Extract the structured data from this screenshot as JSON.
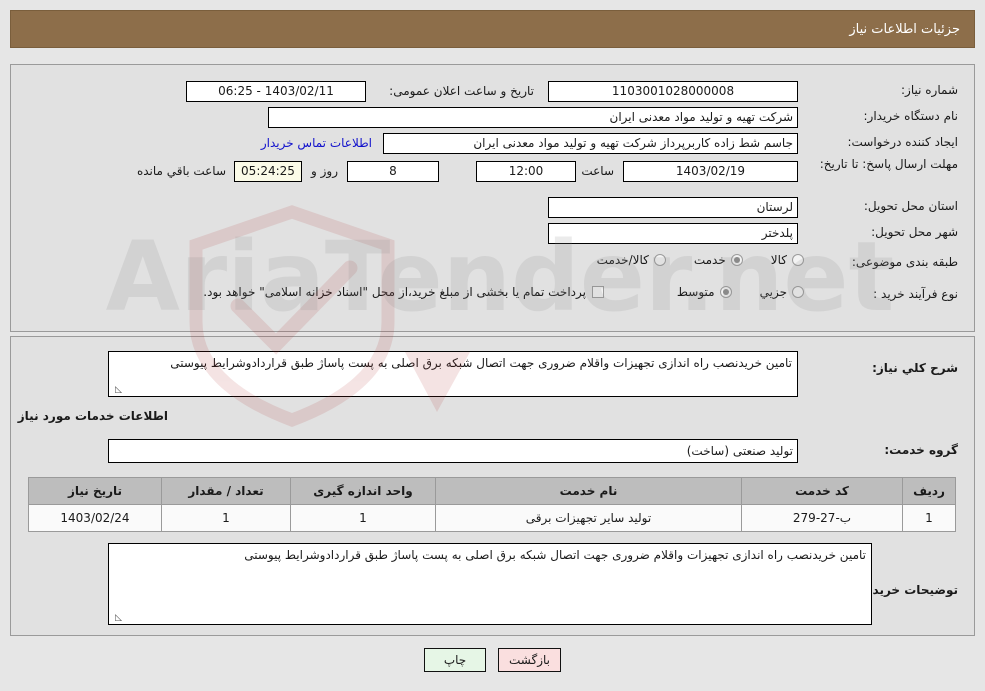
{
  "header": {
    "title": "جزئیات اطلاعات نیاز",
    "bar_color": "#8d6e4a"
  },
  "top_panel": {
    "need_number": {
      "label": "شماره نیاز:",
      "value": "1103001028000008"
    },
    "announce": {
      "label": "تاریخ و ساعت اعلان عمومی:",
      "value": "1403/02/11 - 06:25"
    },
    "buyer_org": {
      "label": "نام دستگاه خریدار:",
      "value": "شرکت تهیه و تولید مواد معدنی ایران"
    },
    "requester": {
      "label": "ایجاد کننده درخواست:",
      "value": "جاسم شط زاده کاربرپرداز شرکت تهیه و تولید مواد معدنی ایران"
    },
    "contact_link": "اطلاعات تماس خریدار",
    "deadline": {
      "label": "مهلت ارسال پاسخ: تا تاریخ:",
      "date": "1403/02/19",
      "time_label": "ساعت",
      "time": "12:00",
      "days": "8",
      "days_unit": "روز و",
      "remaining": "05:24:25",
      "remaining_label": "ساعت باقي مانده"
    },
    "province": {
      "label": "استان محل تحویل:",
      "value": "لرستان"
    },
    "city": {
      "label": "شهر محل تحویل:",
      "value": "پلدختر"
    },
    "category": {
      "label": "طبقه بندی موضوعی:",
      "options": [
        "کالا",
        "خدمت",
        "کالا/خدمت"
      ],
      "selected": "خدمت"
    },
    "process_type": {
      "label": "نوع فرآیند خرید :",
      "options": [
        "جزیي",
        "متوسط"
      ],
      "selected": "متوسط"
    },
    "treasury": {
      "checked": false,
      "text": "پرداخت تمام یا بخشی از مبلغ خرید،از محل \"اسناد خزانه اسلامی\" خواهد بود."
    }
  },
  "middle_panel": {
    "need_summary": {
      "label": "شرح کلي نیاز:",
      "value": "تامین خریدنصب راه اندازی تجهیزات واقلام ضروری جهت اتصال شبکه برق اصلی به پست پاساژ طبق قراردادوشرایط پیوستی"
    },
    "services_heading": "اطلاعات خدمات مورد نیاز",
    "service_group": {
      "label": "گروه خدمت:",
      "value": "تولید صنعتی (ساخت)"
    },
    "table": {
      "columns": [
        "ردیف",
        "کد خدمت",
        "نام خدمت",
        "واحد اندازه گیری",
        "تعداد / مقدار",
        "تاریخ نیاز"
      ],
      "rows": [
        [
          "1",
          "ب-27-279",
          "تولید سایر تجهیزات برقی",
          "1",
          "1",
          "1403/02/24"
        ]
      ]
    },
    "buyer_notes": {
      "label": "توضیحات خریدار:",
      "value": "تامین خریدنصب راه اندازی تجهیزات واقلام ضروری جهت اتصال شبکه برق اصلی به پست پاساژ طبق قراردادوشرایط پیوستی"
    }
  },
  "footer": {
    "back_button": "بازگشت",
    "print_button": "چاپ"
  },
  "watermark": {
    "text": "AriaTender.net"
  }
}
